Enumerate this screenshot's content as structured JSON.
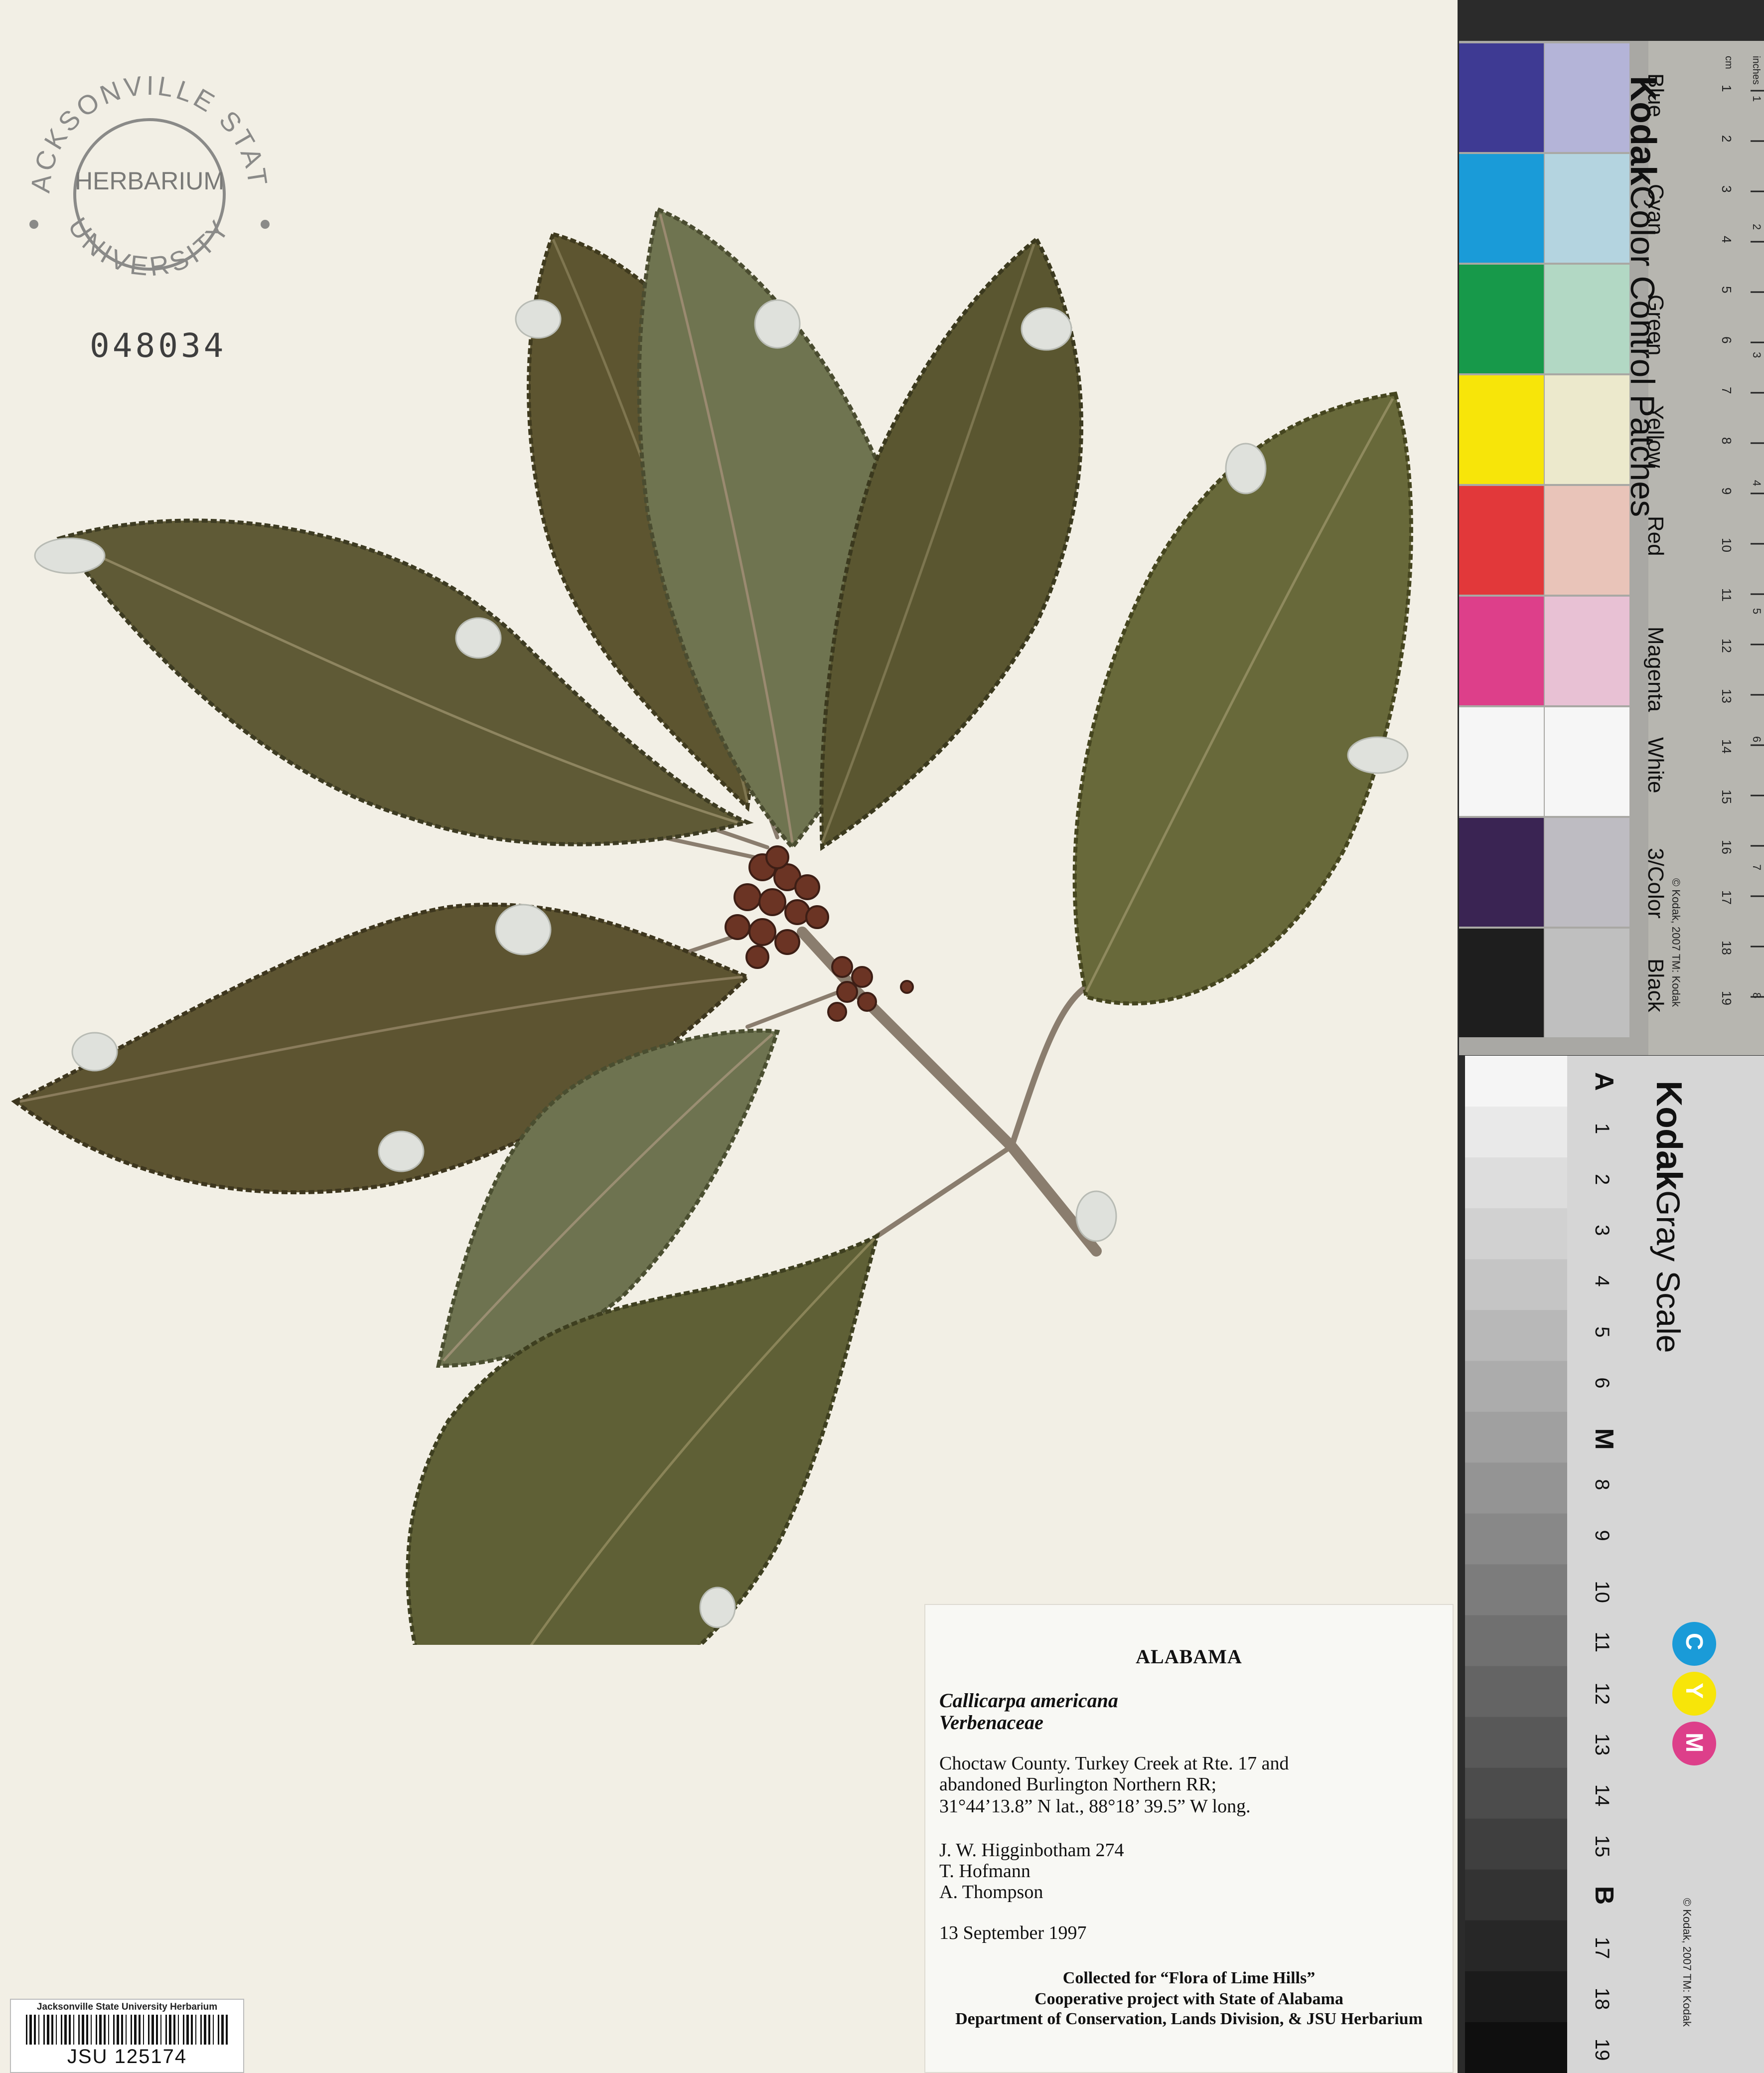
{
  "stamp": {
    "top_text": "JACKSONVILLE STATE",
    "center_text": "HERBARIUM",
    "bottom_text": "UNIVERSITY"
  },
  "accession_number": "048034",
  "label": {
    "state": "ALABAMA",
    "species": "Callicarpa americana",
    "family": "Verbenaceae",
    "locality_line1": "Choctaw County.  Turkey Creek at Rte. 17 and",
    "locality_line2": "abandoned Burlington Northern RR;",
    "coordinates": "31°44’13.8” N lat.,  88°18’ 39.5” W long.",
    "collector1": "J. W. Higginbotham  274",
    "collector2": "T. Hofmann",
    "collector3": "A. Thompson",
    "date": "13 September 1997",
    "credit_line1": "Collected for “Flora of Lime Hills”",
    "credit_line2": "Cooperative project with State of Alabama",
    "credit_line3": "Department of Conservation, Lands Division, & JSU Herbarium"
  },
  "barcode": {
    "institution": "Jacksonville State University Herbarium",
    "number": "JSU 125174"
  },
  "color_card": {
    "brand": "Kodak",
    "title": "Color Control Patches",
    "copyright": "© Kodak, 2007 TM: Kodak",
    "ruler_units": [
      "inches",
      "cm"
    ],
    "cm_ticks": [
      "1",
      "2",
      "3",
      "4",
      "5",
      "6",
      "7",
      "8",
      "9",
      "10",
      "11",
      "12",
      "13",
      "14",
      "15",
      "16",
      "17",
      "18",
      "19"
    ],
    "inch_ticks": [
      "1",
      "2",
      "3",
      "4",
      "5",
      "6",
      "7",
      "8"
    ],
    "patches": [
      {
        "name": "Blue",
        "color": "#3e3a93",
        "tint": "#b4b4d8"
      },
      {
        "name": "Cyan",
        "color": "#1a9bd8",
        "tint": "#b4d4e0"
      },
      {
        "name": "Green",
        "color": "#17994a",
        "tint": "#b2d8c4"
      },
      {
        "name": "Yellow",
        "color": "#f7e509",
        "tint": "#ece9cc"
      },
      {
        "name": "Red",
        "color": "#e2383a",
        "tint": "#e9c4b9"
      },
      {
        "name": "Magenta",
        "color": "#dd3f8a",
        "tint": "#e8c1d4"
      },
      {
        "name": "White",
        "color": "#f6f6f6",
        "tint": "#f6f6f6"
      },
      {
        "name": "3/Color",
        "color": "#3a2453",
        "tint": "#bebcc2"
      },
      {
        "name": "Black",
        "color": "#1e1e1e",
        "tint": "#bfbfbf"
      }
    ]
  },
  "gray_scale": {
    "brand": "Kodak",
    "title": "Gray Scale",
    "copyright": "© Kodak, 2007 TM: Kodak",
    "steps": [
      "A",
      "1",
      "2",
      "3",
      "4",
      "5",
      "6",
      "M",
      "8",
      "9",
      "10",
      "11",
      "12",
      "13",
      "14",
      "15",
      "B",
      "17",
      "18",
      "19"
    ],
    "cmy": [
      {
        "letter": "C",
        "color": "#1a9bd8"
      },
      {
        "letter": "Y",
        "color": "#f7e509"
      },
      {
        "letter": "M",
        "color": "#dd3f8a"
      }
    ]
  }
}
